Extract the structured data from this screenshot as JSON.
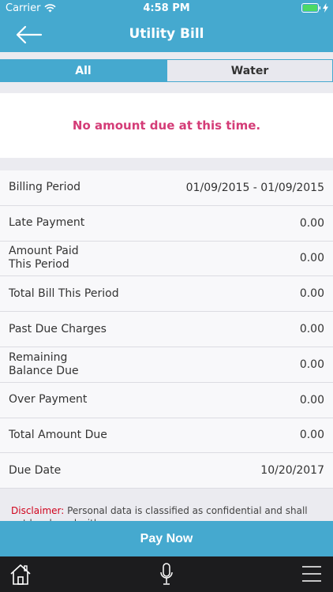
{
  "status_bar": {
    "carrier": "Carrier",
    "time": "4:58 PM"
  },
  "header": {
    "title": "Utility Bill"
  },
  "tabs": [
    {
      "label": "All",
      "selected": true
    },
    {
      "label": "Water",
      "selected": false
    }
  ],
  "notice": {
    "message": "No amount due at this time."
  },
  "details": [
    {
      "label": "Billing Period",
      "value": "01/09/2015 - 01/09/2015"
    },
    {
      "label": "Late Payment",
      "value": "0.00"
    },
    {
      "label": "Amount Paid\nThis Period",
      "value": "0.00"
    },
    {
      "label": "Total Bill This Period",
      "value": "0.00"
    },
    {
      "label": "Past Due Charges",
      "value": "0.00"
    },
    {
      "label": "Remaining\nBalance Due",
      "value": "0.00"
    },
    {
      "label": "Over Payment",
      "value": "0.00"
    },
    {
      "label": "Total Amount Due",
      "value": "0.00"
    },
    {
      "label": "Due Date",
      "value": "10/20/2017"
    }
  ],
  "disclaimer": {
    "tag": "Disclaimer:",
    "text": " Personal data is classified as confidential and shall not be shared with anyone."
  },
  "actions": {
    "pay_now": "Pay Now"
  },
  "colors": {
    "primary": "#45a9cf",
    "notice": "#d43c77",
    "disclaimer": "#d0021b",
    "battery": "#4cd964"
  },
  "icons": {
    "back": "arrow-left-icon",
    "home": "home-icon",
    "mic": "microphone-icon",
    "menu": "hamburger-menu-icon"
  }
}
